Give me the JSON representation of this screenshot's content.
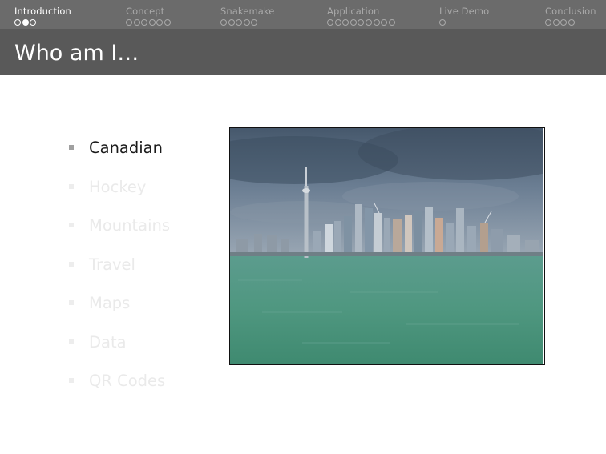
{
  "nav": {
    "sections": [
      {
        "label": "Introduction",
        "dots": 3,
        "current_dot": 2,
        "active": true
      },
      {
        "label": "Concept",
        "dots": 6,
        "current_dot": 0,
        "active": false
      },
      {
        "label": "Snakemake",
        "dots": 5,
        "current_dot": 0,
        "active": false
      },
      {
        "label": "Application",
        "dots": 9,
        "current_dot": 0,
        "active": false
      },
      {
        "label": "Live Demo",
        "dots": 1,
        "current_dot": 0,
        "active": false
      },
      {
        "label": "Conclusion",
        "dots": 4,
        "current_dot": 0,
        "active": false
      }
    ]
  },
  "slide": {
    "title": "Who am I…",
    "bullets": [
      {
        "label": "Canadian",
        "active": true
      },
      {
        "label": "Hockey",
        "active": false
      },
      {
        "label": "Mountains",
        "active": false
      },
      {
        "label": "Travel",
        "active": false
      },
      {
        "label": "Maps",
        "active": false
      },
      {
        "label": "Data",
        "active": false
      },
      {
        "label": "QR Codes",
        "active": false
      }
    ],
    "image": {
      "icon": "toronto-skyline-photo"
    }
  },
  "colors": {
    "navbar": "#6b6b6b",
    "titlebar": "#595959",
    "active_text": "#1a1a1a",
    "inactive_text": "#eaeaea",
    "sky": "#5b6e82",
    "water": "#4f9a80"
  }
}
